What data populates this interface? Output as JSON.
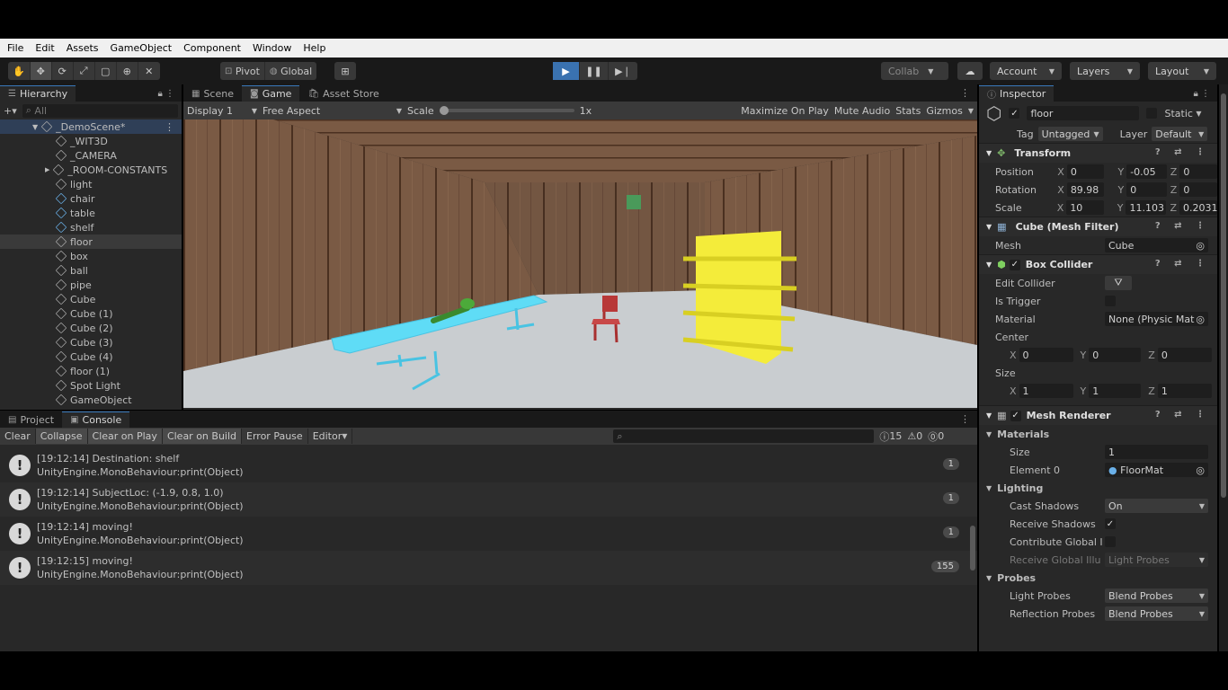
{
  "menu": [
    "File",
    "Edit",
    "Assets",
    "GameObject",
    "Component",
    "Window",
    "Help"
  ],
  "toolbar": {
    "pivot": "Pivot",
    "global": "Global",
    "collab": "Collab",
    "account": "Account",
    "layers": "Layers",
    "layout": "Layout"
  },
  "hierarchy": {
    "tab": "Hierarchy",
    "search_placeholder": "All",
    "scene": "_DemoScene*",
    "items": [
      "_WIT3D",
      "_CAMERA",
      "_ROOM-CONSTANTS",
      "light",
      "chair",
      "table",
      "shelf",
      "floor",
      "box",
      "ball",
      "pipe",
      "Cube",
      "Cube (1)",
      "Cube (2)",
      "Cube (3)",
      "Cube (4)",
      "floor (1)",
      "Spot Light",
      "GameObject"
    ]
  },
  "view": {
    "tabs": [
      "Scene",
      "Game",
      "Asset Store"
    ],
    "display": "Display 1",
    "aspect": "Free Aspect",
    "scale_label": "Scale",
    "scale_value": "1x",
    "maximize": "Maximize On Play",
    "mute": "Mute Audio",
    "stats": "Stats",
    "gizmos": "Gizmos"
  },
  "bottom": {
    "tabs": [
      "Project",
      "Console"
    ],
    "buttons": [
      "Clear",
      "Collapse",
      "Clear on Play",
      "Clear on Build",
      "Error Pause",
      "Editor"
    ],
    "count_info": "15",
    "count_warn": "0",
    "count_err": "0",
    "logs": [
      {
        "line1": "[19:12:14] Destination: shelf",
        "line2": "UnityEngine.MonoBehaviour:print(Object)",
        "count": "1"
      },
      {
        "line1": "[19:12:14] SubjectLoc: (-1.9, 0.8, 1.0)",
        "line2": "UnityEngine.MonoBehaviour:print(Object)",
        "count": "1"
      },
      {
        "line1": "[19:12:14] moving!",
        "line2": "UnityEngine.MonoBehaviour:print(Object)",
        "count": "1"
      },
      {
        "line1": "[19:12:15] moving!",
        "line2": "UnityEngine.MonoBehaviour:print(Object)",
        "count": "155"
      }
    ]
  },
  "inspector": {
    "tab": "Inspector",
    "object_name": "floor",
    "static": "Static",
    "tag_label": "Tag",
    "tag": "Untagged",
    "layer_label": "Layer",
    "layer": "Default",
    "transform": {
      "title": "Transform",
      "position_label": "Position",
      "px": "0",
      "py": "-0.05",
      "pz": "0",
      "rotation_label": "Rotation",
      "rx": "89.98",
      "ry": "0",
      "rz": "0",
      "scale_label": "Scale",
      "sx": "10",
      "sy": "11.103",
      "sz": "0.2031"
    },
    "mesh_filter": {
      "title": "Cube (Mesh Filter)",
      "mesh_label": "Mesh",
      "mesh": "Cube"
    },
    "box_collider": {
      "title": "Box Collider",
      "edit_label": "Edit Collider",
      "trigger_label": "Is Trigger",
      "material_label": "Material",
      "material": "None (Physic Mat",
      "center_label": "Center",
      "cx": "0",
      "cy": "0",
      "cz": "0",
      "size_label": "Size",
      "sx": "1",
      "sy": "1",
      "sz": "1"
    },
    "mesh_renderer": {
      "title": "Mesh Renderer",
      "materials_label": "Materials",
      "size_label": "Size",
      "size": "1",
      "element_label": "Element 0",
      "element": "FloorMat",
      "lighting_label": "Lighting",
      "cast_label": "Cast Shadows",
      "cast": "On",
      "receive_label": "Receive Shadows",
      "contribute_label": "Contribute Global I",
      "receive_gi_label": "Receive Global Illu",
      "receive_gi": "Light Probes",
      "probes_label": "Probes",
      "light_probes_label": "Light Probes",
      "light_probes": "Blend Probes",
      "reflection_label": "Reflection Probes",
      "reflection": "Blend Probes"
    }
  }
}
